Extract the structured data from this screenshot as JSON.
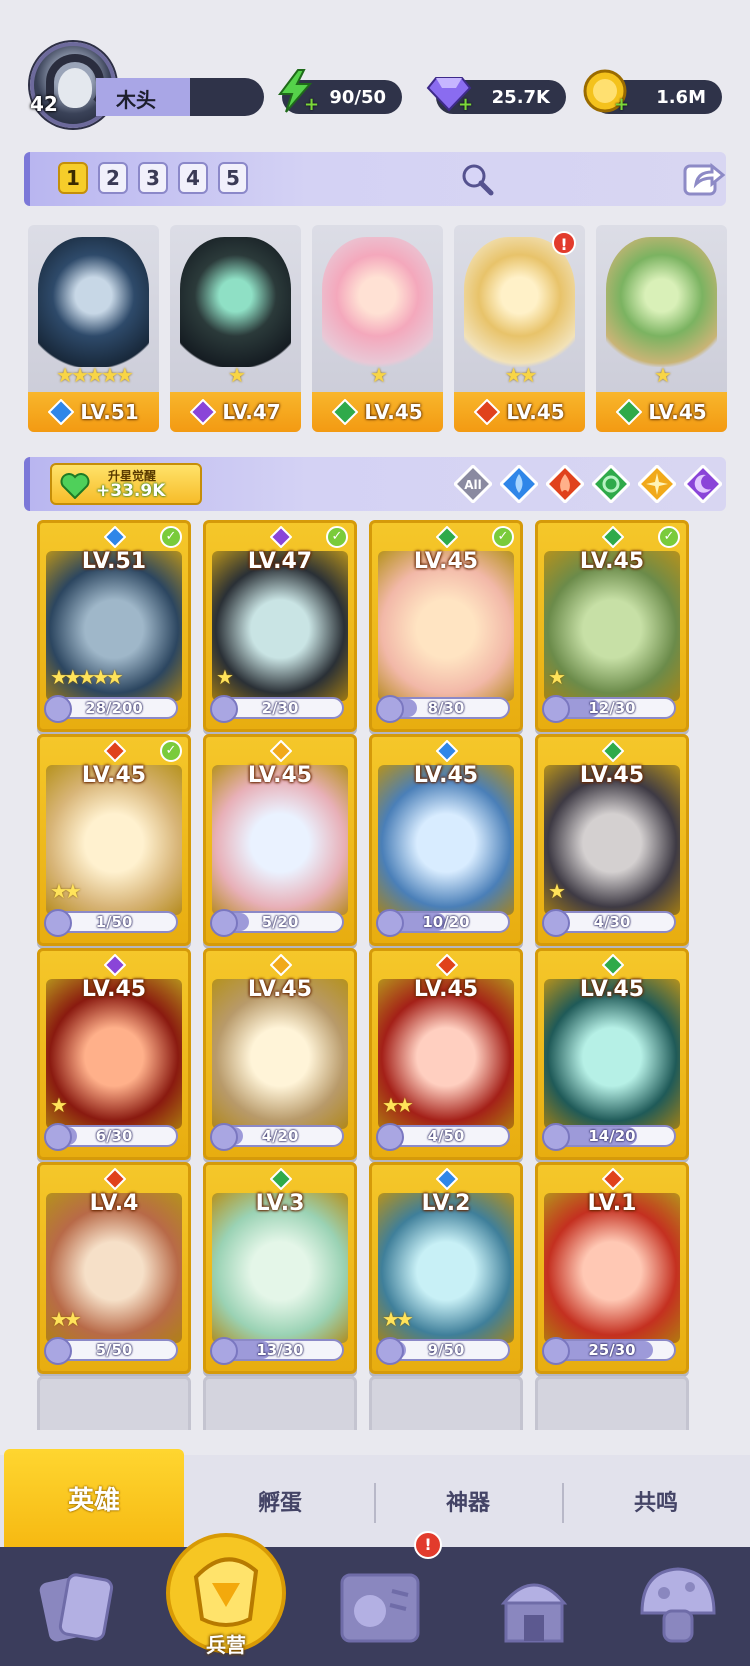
{
  "player": {
    "level": "42",
    "name": "木头"
  },
  "resources": [
    {
      "name": "energy",
      "value": "90/50",
      "icon": "lightning-icon",
      "color": "#55d24a"
    },
    {
      "name": "gems",
      "value": "25.7K",
      "icon": "diamond-icon",
      "color": "#8a6cf0"
    },
    {
      "name": "gold",
      "value": "1.6M",
      "icon": "coin-icon",
      "color": "#f4c21c"
    }
  ],
  "team": {
    "slots": [
      "1",
      "2",
      "3",
      "4",
      "5"
    ],
    "active_slot": "1",
    "heroes": [
      {
        "level": "LV.51",
        "element": "water",
        "stars": "★★★★★",
        "alert": false
      },
      {
        "level": "LV.47",
        "element": "moon",
        "stars": "★",
        "alert": false
      },
      {
        "level": "LV.45",
        "element": "wind",
        "stars": "★",
        "alert": false
      },
      {
        "level": "LV.45",
        "element": "fire",
        "stars": "★★",
        "alert": true
      },
      {
        "level": "LV.45",
        "element": "wind",
        "stars": "★",
        "alert": false
      }
    ]
  },
  "star_up": {
    "label": "升星觉醒",
    "value": "+33.9K"
  },
  "filters": {
    "all_label": "All",
    "elements": [
      "water",
      "fire",
      "wind",
      "light",
      "moon"
    ]
  },
  "heroes": [
    {
      "level": "LV.51",
      "element": "water",
      "check": true,
      "stars": "★★★★★",
      "fragments": "28/200",
      "progress": 0.14
    },
    {
      "level": "LV.47",
      "element": "moon",
      "check": true,
      "stars": "★",
      "fragments": "2/30",
      "progress": 0.07
    },
    {
      "level": "LV.45",
      "element": "wind",
      "check": true,
      "stars": "",
      "fragments": "8/30",
      "progress": 0.27
    },
    {
      "level": "LV.45",
      "element": "wind",
      "check": true,
      "stars": "★",
      "fragments": "12/30",
      "progress": 0.4
    },
    {
      "level": "LV.45",
      "element": "fire",
      "check": true,
      "stars": "★★",
      "fragments": "1/50",
      "progress": 0.02
    },
    {
      "level": "LV.45",
      "element": "light",
      "check": false,
      "stars": "",
      "fragments": "5/20",
      "progress": 0.25
    },
    {
      "level": "LV.45",
      "element": "water",
      "check": false,
      "stars": "",
      "fragments": "10/20",
      "progress": 0.5
    },
    {
      "level": "LV.45",
      "element": "wind",
      "check": false,
      "stars": "★",
      "fragments": "4/30",
      "progress": 0.13
    },
    {
      "level": "LV.45",
      "element": "moon",
      "check": false,
      "stars": "★",
      "fragments": "6/30",
      "progress": 0.2
    },
    {
      "level": "LV.45",
      "element": "light",
      "check": false,
      "stars": "",
      "fragments": "4/20",
      "progress": 0.2
    },
    {
      "level": "LV.45",
      "element": "fire",
      "check": false,
      "stars": "★★",
      "fragments": "4/50",
      "progress": 0.08
    },
    {
      "level": "LV.45",
      "element": "wind",
      "check": false,
      "stars": "",
      "fragments": "14/20",
      "progress": 0.7
    },
    {
      "level": "LV.4",
      "element": "fire",
      "check": false,
      "stars": "★★",
      "fragments": "5/50",
      "progress": 0.1
    },
    {
      "level": "LV.3",
      "element": "wind",
      "check": false,
      "stars": "",
      "fragments": "13/30",
      "progress": 0.43
    },
    {
      "level": "LV.2",
      "element": "water",
      "check": false,
      "stars": "★★",
      "fragments": "9/50",
      "progress": 0.18
    },
    {
      "level": "LV.1",
      "element": "fire",
      "check": false,
      "stars": "",
      "fragments": "25/30",
      "progress": 0.83
    }
  ],
  "subtabs": [
    {
      "label": "英雄",
      "active": true
    },
    {
      "label": "孵蛋",
      "active": false
    },
    {
      "label": "神器",
      "active": false
    },
    {
      "label": "共鸣",
      "active": false
    }
  ],
  "nav": {
    "barracks_label": "兵营",
    "items": [
      "cards-icon",
      "barracks-icon",
      "map-book-icon",
      "temple-icon",
      "mushroom-icon"
    ],
    "map_alert": "!"
  },
  "element_colors": {
    "water": "#2f86e8",
    "moon": "#8a45d8",
    "wind": "#2faa4a",
    "fire": "#e0421c",
    "light": "#f1a91a"
  }
}
